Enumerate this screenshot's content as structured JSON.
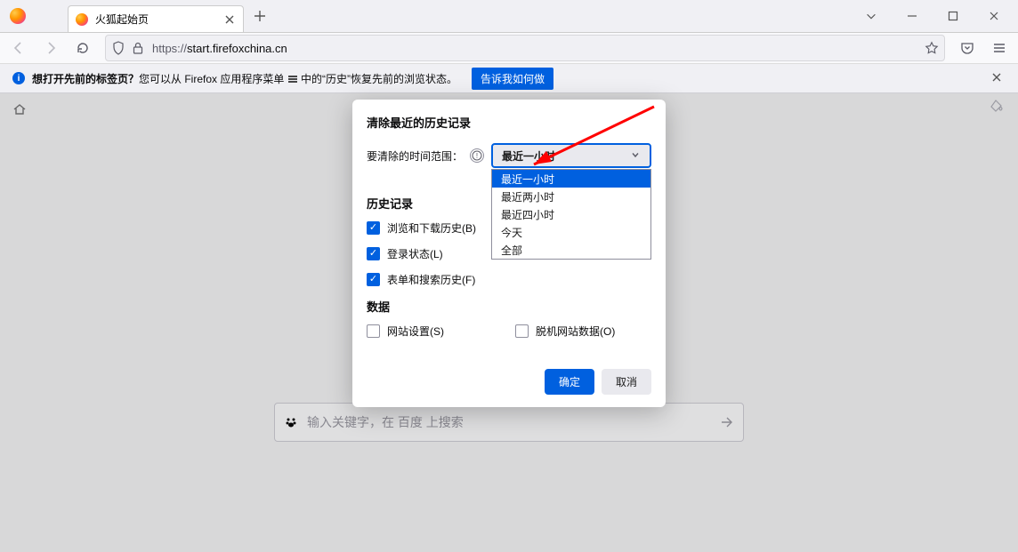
{
  "tab": {
    "title": "火狐起始页"
  },
  "url": {
    "scheme": "https://",
    "host": "start.firefoxchina.cn"
  },
  "infobar": {
    "bold": "想打开先前的标签页？",
    "rest1": "您可以从 Firefox 应用程序菜单 ",
    "rest2": " 中的“历史”恢复先前的浏览状态。",
    "button": "告诉我如何做"
  },
  "search": {
    "placeholder": "输入关键字，在 百度 上搜索"
  },
  "dialog": {
    "title": "清除最近的历史记录",
    "range_label": "要清除的时间范围：",
    "range_value": "最近一小时",
    "options": [
      "最近一小时",
      "最近两小时",
      "最近四小时",
      "今天",
      "全部"
    ],
    "section_history": "历史记录",
    "chk_browse": "浏览和下载历史(B)",
    "chk_login": "登录状态(L)",
    "chk_form": "表单和搜索历史(F)",
    "section_data": "数据",
    "chk_site": "网站设置(S)",
    "chk_offline": "脱机网站数据(O)",
    "ok": "确定",
    "cancel": "取消"
  }
}
